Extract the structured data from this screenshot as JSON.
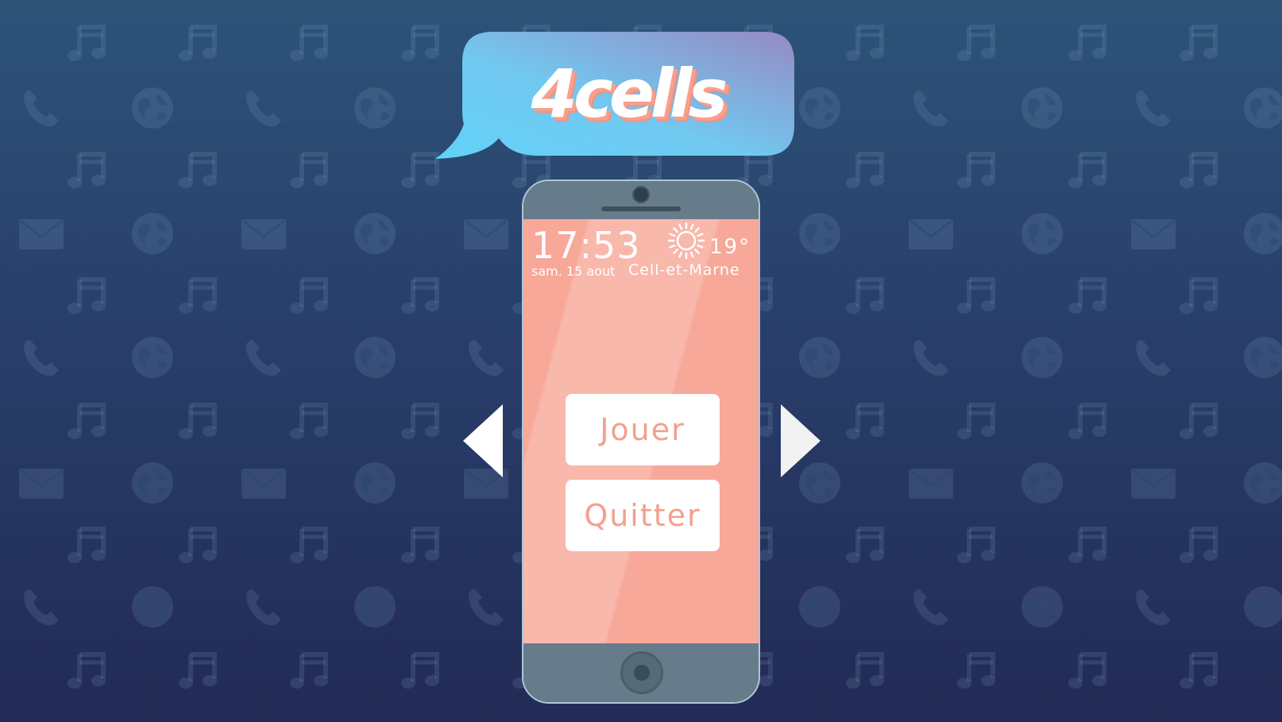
{
  "logo": {
    "text": "4cells"
  },
  "phone": {
    "clock": "17:53",
    "date": "sam. 15 aout",
    "temperature": "19°",
    "location": "Cell-et-Marne",
    "weather_icon": "sun-icon"
  },
  "menu": {
    "play_label": "Jouer",
    "quit_label": "Quitter"
  },
  "navigation": {
    "prev_icon": "triangle-left-icon",
    "next_icon": "triangle-right-icon"
  },
  "background": {
    "pattern_icons": [
      "music-note-icon",
      "phone-icon",
      "globe-icon",
      "envelope-icon"
    ]
  },
  "colors": {
    "background_top": "#2d5378",
    "background_bottom": "#222b55",
    "screen": "#f7a898",
    "button_text": "#f4a08f",
    "logo_bubble_start": "#66cdf5",
    "logo_bubble_end": "#8e88c4",
    "logo_shadow": "#f4917e"
  }
}
